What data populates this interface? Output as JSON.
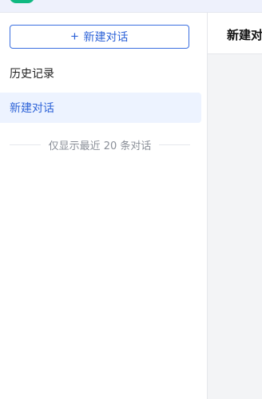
{
  "sidebar": {
    "new_chat_label": "新建对话",
    "history_heading": "历史记录",
    "conversations": [
      {
        "title": "新建对话",
        "active": true
      }
    ],
    "limit_note": "仅显示最近 20 条对话"
  },
  "main": {
    "title": "新建对话"
  },
  "colors": {
    "accent": "#2f64d8",
    "active_bg": "#edf3ff",
    "logo": "#10b981"
  },
  "icons": {
    "new_chat": "plus-icon"
  }
}
